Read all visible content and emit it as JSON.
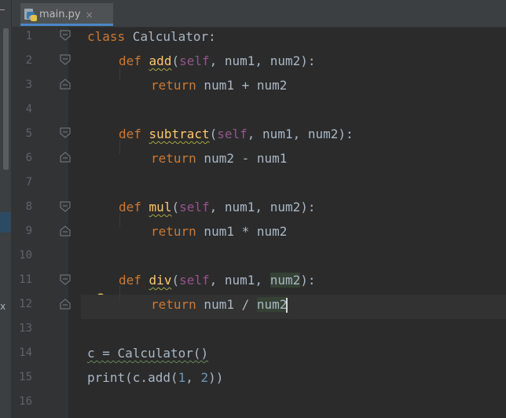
{
  "tab": {
    "filename": "main.py",
    "close_glyph": "×",
    "icon": "python-file-icon"
  },
  "left_strip": {
    "close_glyph": "x"
  },
  "line_numbers": [
    "1",
    "2",
    "3",
    "4",
    "5",
    "6",
    "7",
    "8",
    "9",
    "10",
    "11",
    "12",
    "13",
    "14",
    "15",
    "16"
  ],
  "code": {
    "l1": {
      "kw": "class",
      "name": " Calculator:"
    },
    "l2": {
      "kw": "def",
      "fn": "add",
      "p1": "(",
      "self": "self",
      "rest": ", num1, num2):"
    },
    "l3": {
      "kw": "return",
      "rest": " num1 + num2"
    },
    "l5": {
      "kw": "def",
      "fn": "subtract",
      "p1": "(",
      "self": "self",
      "rest": ", num1, num2):"
    },
    "l6": {
      "kw": "return",
      "rest": " num2 - num1"
    },
    "l8": {
      "kw": "def",
      "fn": "mul",
      "p1": "(",
      "self": "self",
      "rest": ", num1, num2):"
    },
    "l9": {
      "kw": "return",
      "rest": " num1 * num2"
    },
    "l11": {
      "kw": "def",
      "fn": "div",
      "p1": "(",
      "self": "self",
      "rest_a": ", num1, ",
      "hl": "num2",
      "rest_b": "):"
    },
    "l12": {
      "kw": "return",
      "rest": " num1 / ",
      "hl": "num2"
    },
    "l14": {
      "text": "c = Calculator()"
    },
    "l15": {
      "text_a": "print(c.add(",
      "n1": "1",
      "comma": ", ",
      "n2": "2",
      "text_b": "))"
    }
  },
  "colors": {
    "background": "#2b2b2b",
    "gutter": "#313335",
    "keyword": "#cc7832",
    "self": "#94558d",
    "function": "#ffc66d",
    "number": "#6897bb",
    "text": "#a9b7c6"
  }
}
